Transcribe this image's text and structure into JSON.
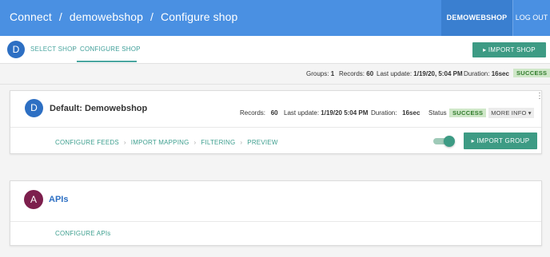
{
  "topbar": {
    "breadcrumbs": [
      "Connect",
      "demowebshop",
      "Configure shop"
    ],
    "separator": "/",
    "store_button": "DEMOWEBSHOP",
    "logout": "LOG OUT",
    "color": "#4a90e2"
  },
  "steps": {
    "avatar_letter": "D",
    "items": [
      "SELECT SHOP",
      "CONFIGURE SHOP"
    ],
    "separator": "›",
    "active_index": 1,
    "import_shop_button": "▸ IMPORT SHOP"
  },
  "status": {
    "groups_label": "Groups:",
    "groups_value": "1",
    "records_label": "Records:",
    "records_value": "60",
    "last_update_label": "Last update:",
    "last_update_value": "1/19/20, 5:04 PM",
    "duration_label": "Duration:",
    "duration_value": "16sec",
    "badge": "SUCCESS"
  },
  "group_card": {
    "avatar_letter": "D",
    "title": "Default: Demowebshop",
    "records_label": "Records:",
    "records_value": "60",
    "last_update_label": "Last update:",
    "last_update_value": "1/19/20 5:04 PM",
    "duration_label": "Duration:",
    "duration_value": "16sec",
    "status_label": "Status",
    "status_badge": "SUCCESS",
    "more_info": "MORE INFO ▾",
    "links": [
      "CONFIGURE FEEDS",
      "IMPORT MAPPING",
      "FILTERING",
      "PREVIEW"
    ],
    "link_separator": "›",
    "toggle_on": true,
    "import_group_button": "▸ IMPORT GROUP"
  },
  "apis_card": {
    "avatar_letter": "A",
    "title": "APIs",
    "link": "CONFIGURE APIs"
  },
  "colors": {
    "accent_teal": "#3d9b84",
    "avatar_blue": "#2d6fc3",
    "avatar_apis": "#7d1f4d",
    "success_bg": "#cfe7c8"
  }
}
